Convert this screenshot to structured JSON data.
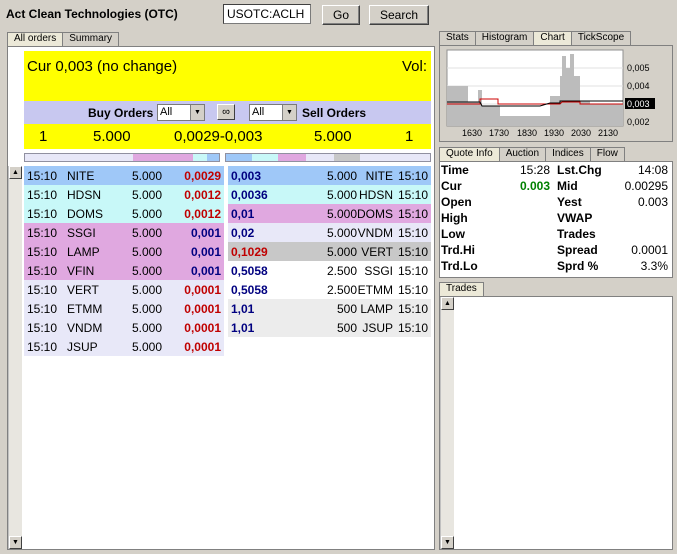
{
  "header": {
    "title": "Act Clean Technologies (OTC)",
    "symbol_value": "USOTC:ACLH",
    "go_label": "Go",
    "search_label": "Search"
  },
  "left_tabs": [
    "All orders",
    "Summary"
  ],
  "right_tabs": [
    "Stats",
    "Histogram",
    "Chart",
    "TickScope"
  ],
  "info_tabs": [
    "Quote Info",
    "Auction",
    "Indices",
    "Flow"
  ],
  "trades_tab": "Trades",
  "quote": {
    "cur_text": "Cur 0,003 (no change)",
    "vol_text": "Vol:"
  },
  "filter": {
    "buy_label": "Buy Orders",
    "sell_label": "Sell Orders",
    "buy_select": "All",
    "sell_select": "All"
  },
  "summary": {
    "buy_count": "1",
    "buy_qty": "5.000",
    "spread_text": "0,0029-0,003",
    "sell_qty": "5.000",
    "sell_count": "1"
  },
  "buy_orders": [
    {
      "time": "15:10",
      "mm": "NITE",
      "qty": "5.000",
      "price": "0,0029",
      "color": "#9fc8f8"
    },
    {
      "time": "15:10",
      "mm": "HDSN",
      "qty": "5.000",
      "price": "0,0012",
      "color": "#c8f8f8"
    },
    {
      "time": "15:10",
      "mm": "DOMS",
      "qty": "5.000",
      "price": "0,0012",
      "color": "#c8f8f8"
    },
    {
      "time": "15:10",
      "mm": "SSGI",
      "qty": "5.000",
      "price": "0,001",
      "color": "#e0a8e0"
    },
    {
      "time": "15:10",
      "mm": "LAMP",
      "qty": "5.000",
      "price": "0,001",
      "color": "#e0a8e0"
    },
    {
      "time": "15:10",
      "mm": "VFIN",
      "qty": "5.000",
      "price": "0,001",
      "color": "#e0a8e0"
    },
    {
      "time": "15:10",
      "mm": "VERT",
      "qty": "5.000",
      "price": "0,0001",
      "color": "#e8e8f8"
    },
    {
      "time": "15:10",
      "mm": "ETMM",
      "qty": "5.000",
      "price": "0,0001",
      "color": "#e8e8f8"
    },
    {
      "time": "15:10",
      "mm": "VNDM",
      "qty": "5.000",
      "price": "0,0001",
      "color": "#e8e8f8"
    },
    {
      "time": "15:10",
      "mm": "JSUP",
      "qty": "5.000",
      "price": "0,0001",
      "color": "#e8e8f8"
    }
  ],
  "sell_orders": [
    {
      "price": "0,003",
      "qty": "5.000",
      "mm": "NITE",
      "time": "15:10",
      "color": "#9fc8f8"
    },
    {
      "price": "0,0036",
      "qty": "5.000",
      "mm": "HDSN",
      "time": "15:10",
      "color": "#c8f8f8"
    },
    {
      "price": "0,01",
      "qty": "5.000",
      "mm": "DOMS",
      "time": "15:10",
      "color": "#e0a8e0"
    },
    {
      "price": "0,02",
      "qty": "5.000",
      "mm": "VNDM",
      "time": "15:10",
      "color": "#e8e8f8"
    },
    {
      "price": "0,1029",
      "qty": "5.000",
      "mm": "VERT",
      "time": "15:10",
      "color": "#c8c8c8"
    },
    {
      "price": "0,5058",
      "qty": "2.500",
      "mm": "SSGI",
      "time": "15:10",
      "color": "#ffffff"
    },
    {
      "price": "0,5058",
      "qty": "2.500",
      "mm": "ETMM",
      "time": "15:10",
      "color": "#ffffff"
    },
    {
      "price": "1,01",
      "qty": "500",
      "mm": "LAMP",
      "time": "15:10",
      "color": "#ececec"
    },
    {
      "price": "1,01",
      "qty": "500",
      "mm": "JSUP",
      "time": "15:10",
      "color": "#ececec"
    }
  ],
  "chart": {
    "x_ticks": [
      "1630",
      "1730",
      "1830",
      "1930",
      "2030",
      "2130"
    ],
    "y_ticks": [
      "0,005",
      "0,004",
      "0,003",
      "0,002"
    ]
  },
  "quote_info": [
    {
      "k1": "Time",
      "v1": "15:28",
      "k2": "Lst.Chg",
      "v2": "14:08"
    },
    {
      "k1": "Cur",
      "v1": "0.003",
      "k2": "Mid",
      "v2": "0.00295"
    },
    {
      "k1": "Open",
      "v1": "",
      "k2": "Yest",
      "v2": "0.003"
    },
    {
      "k1": "High",
      "v1": "",
      "k2": "VWAP",
      "v2": ""
    },
    {
      "k1": "Low",
      "v1": "",
      "k2": "Trades",
      "v2": ""
    },
    {
      "k1": "Trd.Hi",
      "v1": "",
      "k2": "Spread",
      "v2": "0.0001"
    },
    {
      "k1": "Trd.Lo",
      "v1": "",
      "k2": "Sprd %",
      "v2": "3.3%"
    }
  ],
  "colors": {
    "cur_value": "#008000",
    "buy_price": "#c00000",
    "sell_price": "#000080"
  }
}
